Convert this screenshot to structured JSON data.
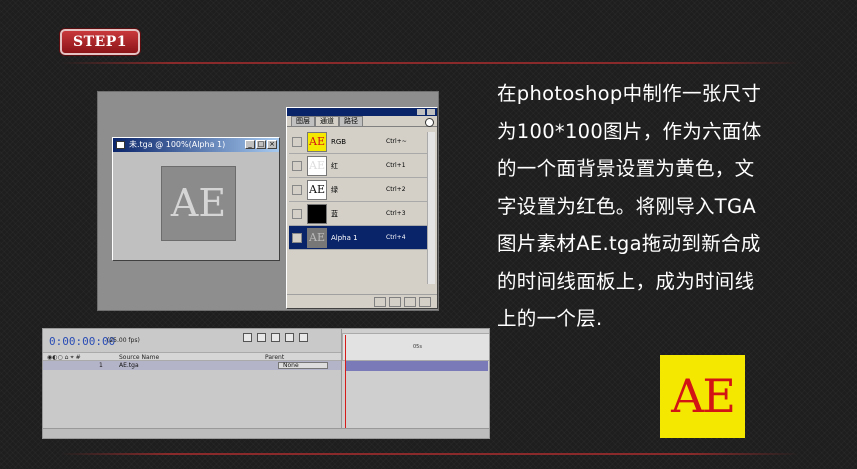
{
  "step_label": "STEP1",
  "photoshop": {
    "doc_title": "未.tga @ 100%(Alpha 1)",
    "canvas_text": "AE",
    "tabs": [
      "图层",
      "通道",
      "路径"
    ],
    "channels": [
      {
        "thumb": "AE",
        "name": "RGB",
        "shortcut": "Ctrl+~"
      },
      {
        "thumb": "AE",
        "name": "红",
        "shortcut": "Ctrl+1"
      },
      {
        "thumb": "AE",
        "name": "绿",
        "shortcut": "Ctrl+2"
      },
      {
        "thumb": "",
        "name": "蓝",
        "shortcut": "Ctrl+3"
      },
      {
        "thumb": "AE",
        "name": "Alpha 1",
        "shortcut": "Ctrl+4"
      }
    ]
  },
  "after_effects": {
    "time": "0:00:00:00",
    "fps": "(25.00 fps)",
    "col_source": "Source Name",
    "col_parent": "Parent",
    "layer_index": "1",
    "layer_name": "AE.tga",
    "parent_value": "None",
    "ruler_mark": "05s"
  },
  "description": "在photoshop中制作一张尺寸\n为100*100图片，作为六面体\n的一个面背景设置为黄色，文\n字设置为红色。将刚导入TGA\n图片素材AE.tga拖动到新合成\n的时间线面板上，成为时间线\n上的一个层.",
  "badge_text": "AE",
  "colors": {
    "badge_bg": "#f5e800",
    "badge_text": "#d21414",
    "step_red": "#b02528"
  }
}
